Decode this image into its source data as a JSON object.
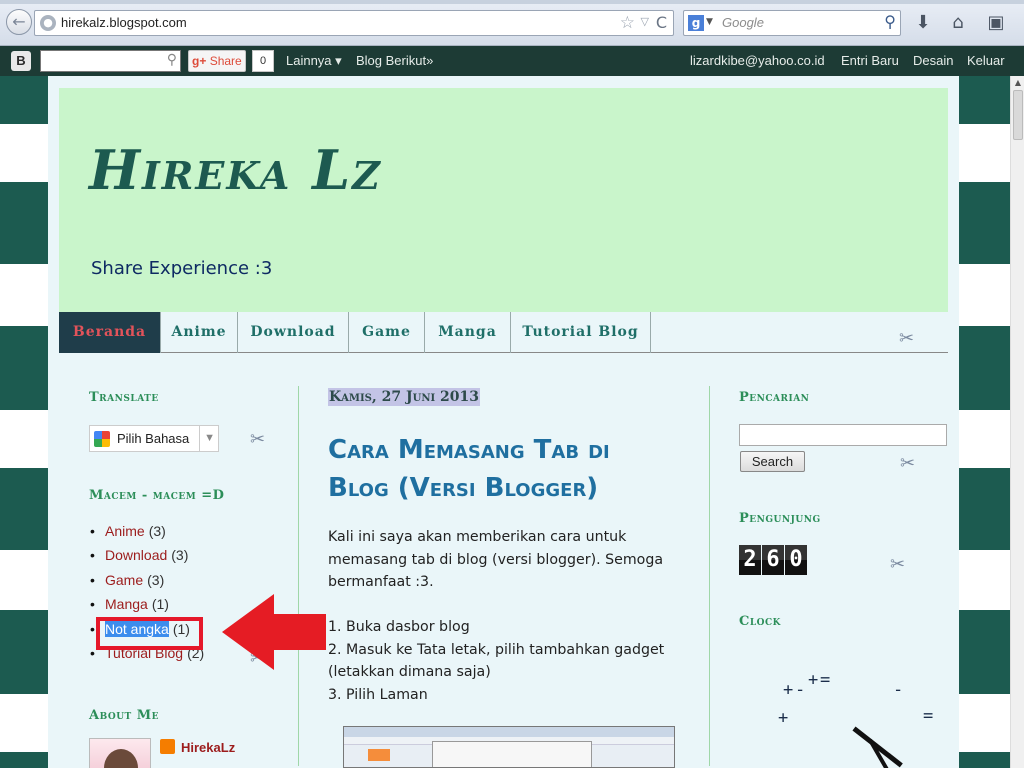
{
  "browser": {
    "url": "hirekalz.blogspot.com",
    "search_placeholder": "Google"
  },
  "navbar": {
    "share_label": "Share",
    "share_count": "0",
    "lainnya": "Lainnya ▾",
    "blog_berikut": "Blog Berikut»",
    "email": "lizardkibe@yahoo.co.id",
    "entri_baru": "Entri Baru",
    "desain": "Desain",
    "keluar": "Keluar"
  },
  "header": {
    "title": "Hireka Lz",
    "description": "Share Experience :3"
  },
  "tabs": [
    "Beranda",
    "Anime",
    "Download",
    "Game",
    "Manga",
    "Tutorial Blog"
  ],
  "sidebar_left": {
    "translate_title": "Translate",
    "translate_select": "Pilih Bahasa",
    "categories_title": "Macem - macem =D",
    "categories": [
      {
        "name": "Anime",
        "count": "(3)"
      },
      {
        "name": "Download",
        "count": "(3)"
      },
      {
        "name": "Game",
        "count": "(3)"
      },
      {
        "name": "Manga",
        "count": "(1)"
      },
      {
        "name": "Not angka",
        "count": "(1)"
      },
      {
        "name": "Tutorial Blog",
        "count": "(2)"
      }
    ],
    "about_title": "About Me",
    "profile_name": "HirekaLz"
  },
  "post": {
    "date": "Kamis, 27 Juni 2013",
    "title": "Cara Memasang Tab di Blog (Versi Blogger)",
    "lines": [
      " Kali ini saya akan memberikan cara untuk",
      "memasang tab di blog (versi blogger). Semoga",
      "bermanfaat :3.",
      "",
      "1. Buka dasbor blog",
      "2. Masuk ke Tata letak, pilih tambahkan gadget",
      "(letakkan dimana saja)",
      "3. Pilih Laman"
    ]
  },
  "sidebar_right": {
    "search_title": "Pencarian",
    "search_button": "Search",
    "visitors_title": "Pengunjung",
    "visitor_count": [
      "2",
      "6",
      "0"
    ],
    "clock_title": "Clock"
  },
  "colors": {
    "navbar_bg": "#1d3b35",
    "header_bg": "#c9f5cb",
    "stripe": "#1c5b50",
    "accent_red": "#e5182a",
    "widget_title": "#2c8e59"
  }
}
